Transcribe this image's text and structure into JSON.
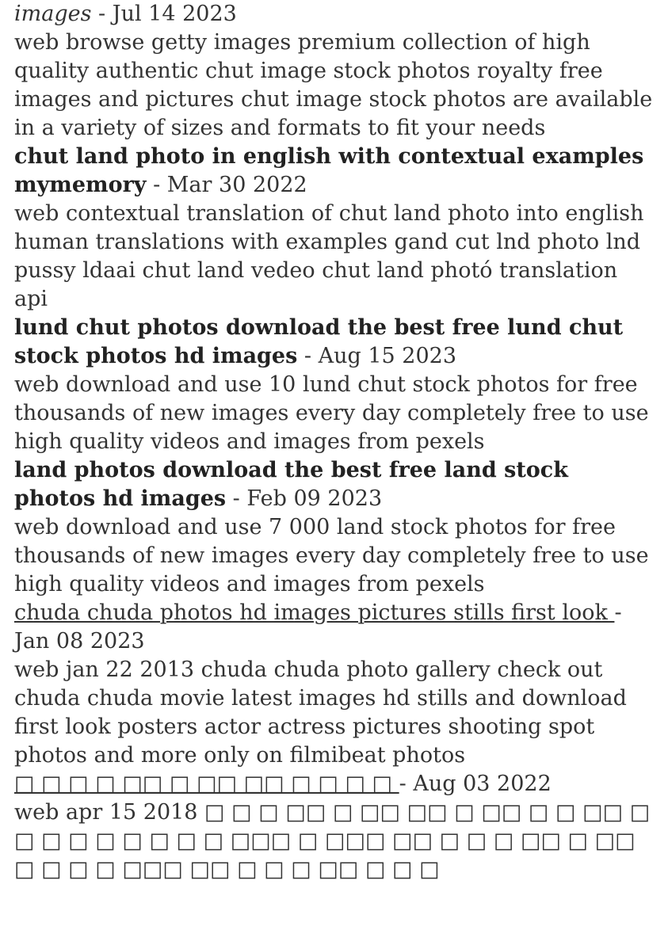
{
  "entries": [
    {
      "title": "images",
      "date": " - Jul 14 2023",
      "snippet": "web browse getty images premium collection of high quality authentic chut image stock photos royalty free images and pictures chut image stock photos are available in a variety of sizes and formats to fit your needs"
    },
    {
      "title": "chut land photo in english with contextual examples mymemory",
      "date": " - Mar 30 2022",
      "snippet": "web contextual translation of chut land photo into english human translations with examples gand cut lnd photo lnd pussy ldaai chut land vedeo chut land photó translation api"
    },
    {
      "title": "lund chut photos download the best free lund chut stock photos hd images",
      "date": " - Aug 15 2023",
      "snippet": "web download and use 10 lund chut stock photos for free thousands of new images every day completely free to use high quality videos and images from pexels"
    },
    {
      "title": "land photos download the best free land stock photos hd images",
      "date": " - Feb 09 2023",
      "snippet": "web download and use 7 000 land stock photos for free thousands of new images every day completely free to use high quality videos and images from pexels"
    },
    {
      "title": "chuda chuda photos hd images pictures stills first look ",
      "date": "- Jan 08 2023",
      "snippet": "web jan 22 2013   chuda chuda photo gallery check out chuda chuda movie latest images hd stills and download first look posters actor actress pictures shooting spot photos and more only on filmibeat photos"
    },
    {
      "title": "□ □ □ □ □□ □ □□ □□ □ □ □ □ ",
      "date": "- Aug 03 2022",
      "snippet": "web apr 15 2018   □ □ □ □□ □ □□ □□ □ □□ □ □ □□ □ □ □ □ □ □ □ □ □ □□□ □ □□□ □□ □ □ □ □□ □ □□ □ □ □ □ □□□ □□ □ □ □ □□ □ □ □"
    }
  ]
}
